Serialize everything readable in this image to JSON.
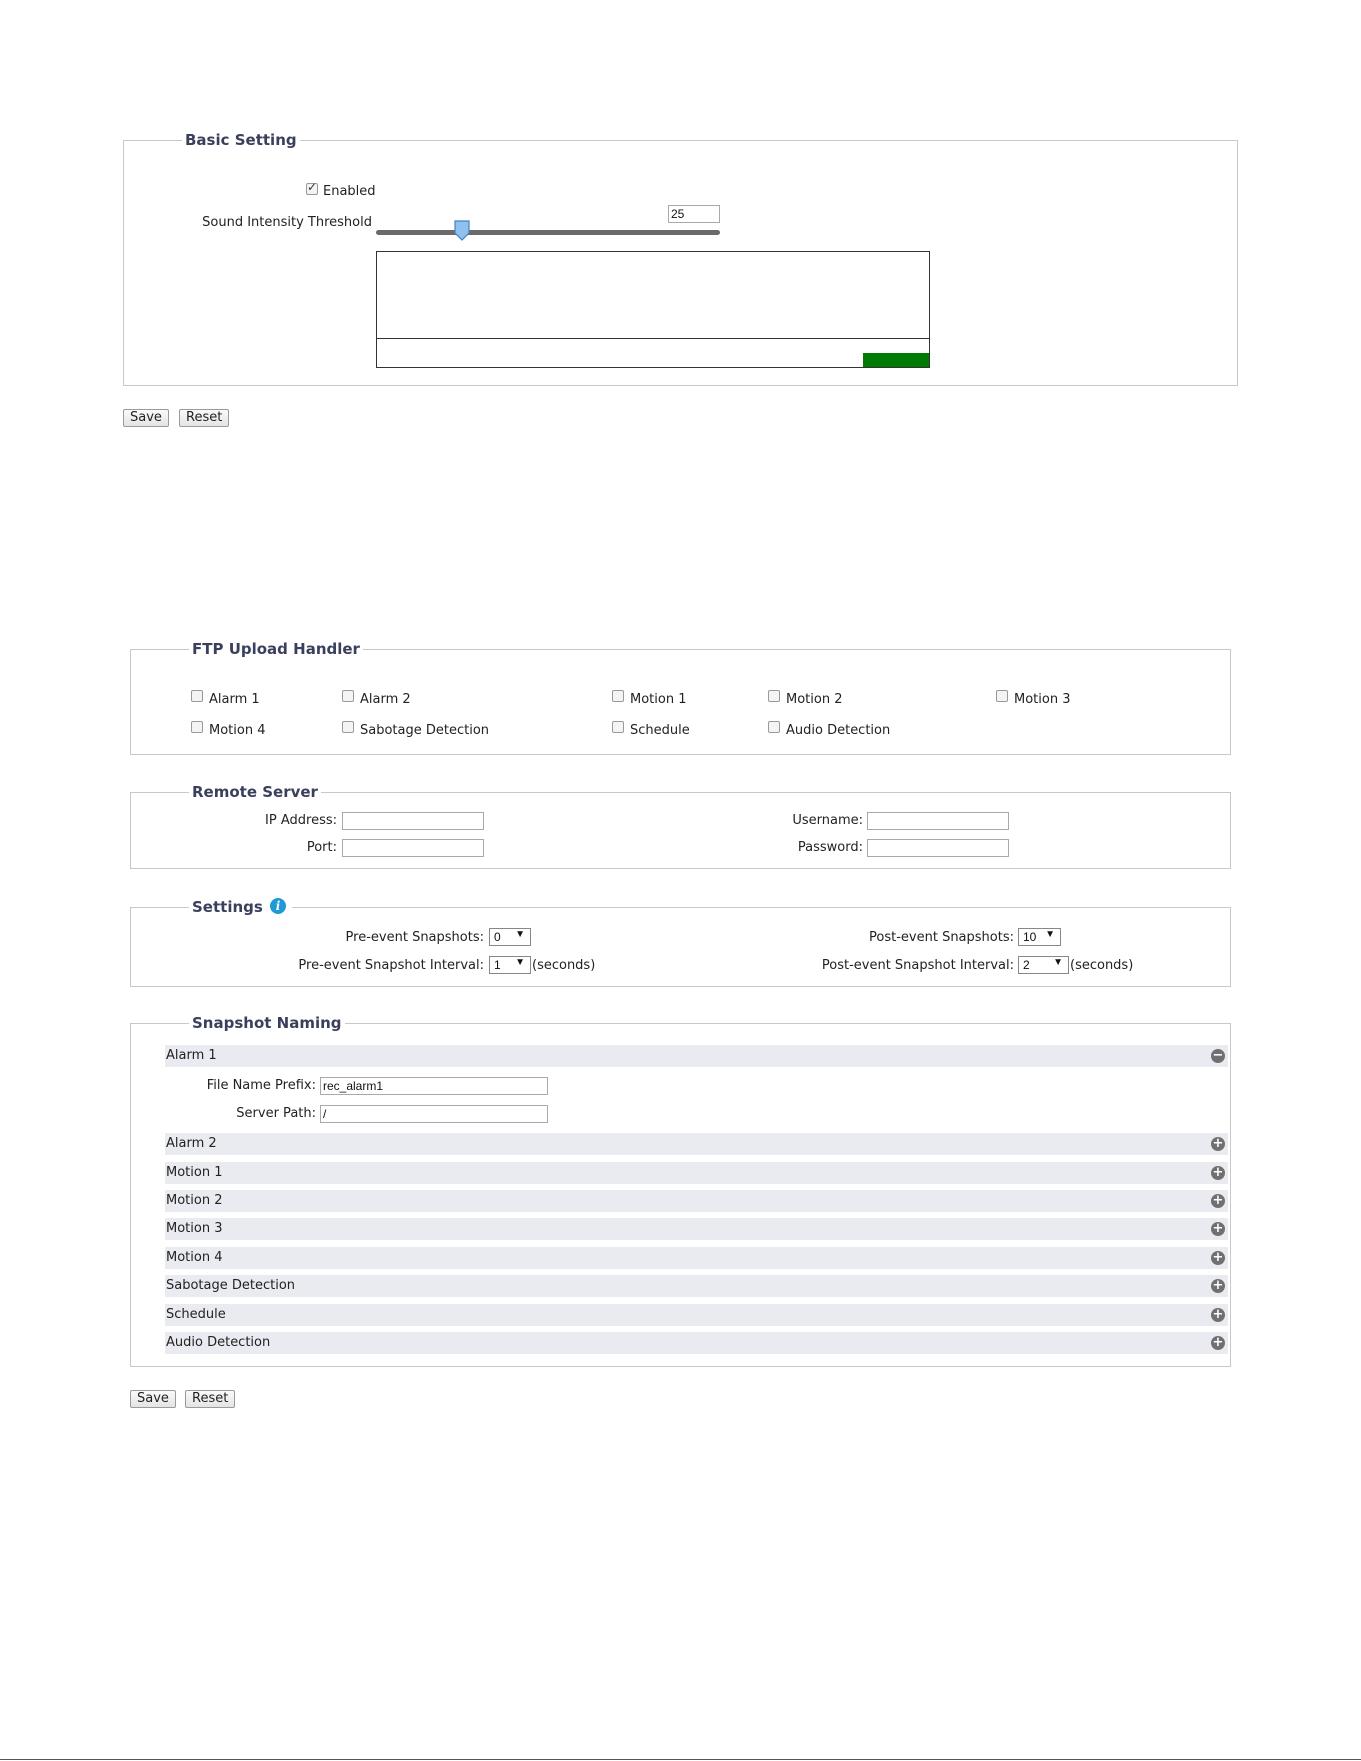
{
  "basic": {
    "legend": "Basic Setting",
    "enabled_label": "Enabled",
    "threshold_label": "Sound Intensity Threshold",
    "threshold_value": "25",
    "slider_fraction": 0.25,
    "meter_level_color": "#007a00",
    "save_label": "Save",
    "reset_label": "Reset"
  },
  "ftp": {
    "legend": "FTP Upload Handler",
    "options": [
      "Alarm 1",
      "Alarm 2",
      "Motion 1",
      "Motion 2",
      "Motion 3",
      "Motion 4",
      "Sabotage Detection",
      "Schedule",
      "Audio Detection"
    ]
  },
  "remote": {
    "legend": "Remote Server",
    "ip_label": "IP Address:",
    "port_label": "Port:",
    "username_label": "Username:",
    "password_label": "Password:"
  },
  "settings": {
    "legend": "Settings",
    "info_icon": "i",
    "pre_snap_label": "Pre-event Snapshots:",
    "pre_snap_value": "0",
    "pre_interval_label": "Pre-event Snapshot Interval:",
    "pre_interval_value": "1",
    "post_snap_label": "Post-event Snapshots:",
    "post_snap_value": "10",
    "post_interval_label": "Post-event Snapshot Interval:",
    "post_interval_value": "2",
    "seconds_label": "(seconds)"
  },
  "naming": {
    "legend": "Snapshot Naming",
    "expanded": {
      "label": "Alarm 1",
      "prefix_label": "File Name Prefix:",
      "prefix_value": "rec_alarm1",
      "path_label": "Server Path:",
      "path_value": "/"
    },
    "collapsed": [
      "Alarm 2",
      "Motion 1",
      "Motion 2",
      "Motion 3",
      "Motion 4",
      "Sabotage Detection",
      "Schedule",
      "Audio Detection"
    ],
    "save_label": "Save",
    "reset_label": "Reset"
  },
  "icons": {
    "collapse": "minus-circle-icon",
    "expand": "plus-circle-icon",
    "dropdown": "triangle-down-icon",
    "info": "info-icon"
  }
}
